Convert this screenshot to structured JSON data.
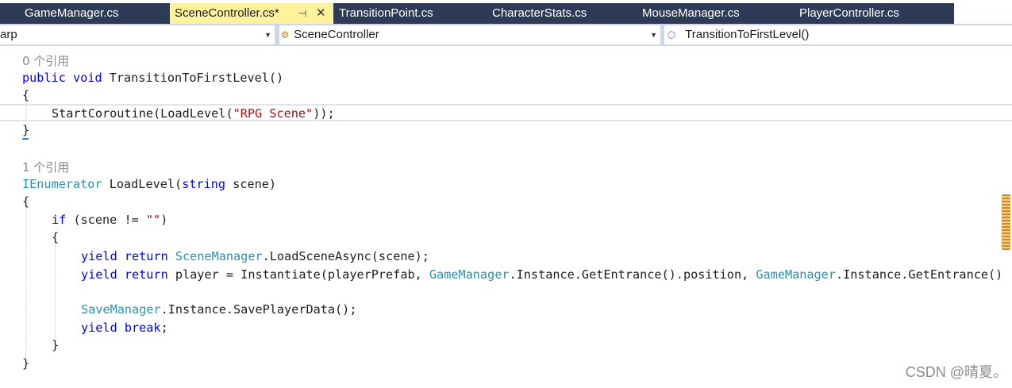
{
  "tabs": [
    {
      "label": "GameManager.cs"
    },
    {
      "label": "SceneController.cs*",
      "pin_icon": "pin-icon",
      "close_icon": "close-icon",
      "active": true
    },
    {
      "label": "TransitionPoint.cs"
    },
    {
      "label": "CharacterStats.cs"
    },
    {
      "label": "MouseManager.cs"
    },
    {
      "label": "PlayerController.cs"
    }
  ],
  "nav": {
    "project": "arp",
    "class": "SceneController",
    "member": "TransitionToFirstLevel()"
  },
  "code": {
    "refs0": "0 个引用",
    "l_sig1_kw1": "public",
    "l_sig1_kw2": "void",
    "l_sig1_name": " TransitionToFirstLevel()",
    "brace_open": "{",
    "l_call_pre": "StartCoroutine(LoadLevel(",
    "l_call_str": "\"RPG Scene\"",
    "l_call_post": "));",
    "brace_close": "}",
    "refs1": "1 个引用",
    "l_sig2_type": "IEnumerator",
    "l_sig2_mid": " LoadLevel(",
    "l_sig2_kw": "string",
    "l_sig2_end": " scene)",
    "l_if_kw": "if",
    "l_if_mid": " (scene != ",
    "l_if_str": "\"\"",
    "l_if_end": ")",
    "l_y1_kw": "yield return",
    "l_y1_type": "SceneManager",
    "l_y1_rest": ".LoadSceneAsync(scene);",
    "l_y2_kw": "yield return",
    "l_y2_mid": " player = Instantiate(playerPrefab, ",
    "l_y2_type1": "GameManager",
    "l_y2_mid2": ".Instance.GetEntrance().position, ",
    "l_y2_type2": "GameManager",
    "l_y2_end": ".Instance.GetEntrance()",
    "l_save_type": "SaveManager",
    "l_save_rest": ".Instance.SavePlayerData();",
    "l_break_kw": "yield break",
    "l_break_end": ";"
  },
  "watermark": "CSDN @晴夏。",
  "colors": {
    "tab_bar": "#2e3b56",
    "active_tab": "#fff29d",
    "keyword": "#0000ff",
    "type": "#2b91af",
    "string": "#a31515",
    "codelens": "#8a8a8a"
  }
}
